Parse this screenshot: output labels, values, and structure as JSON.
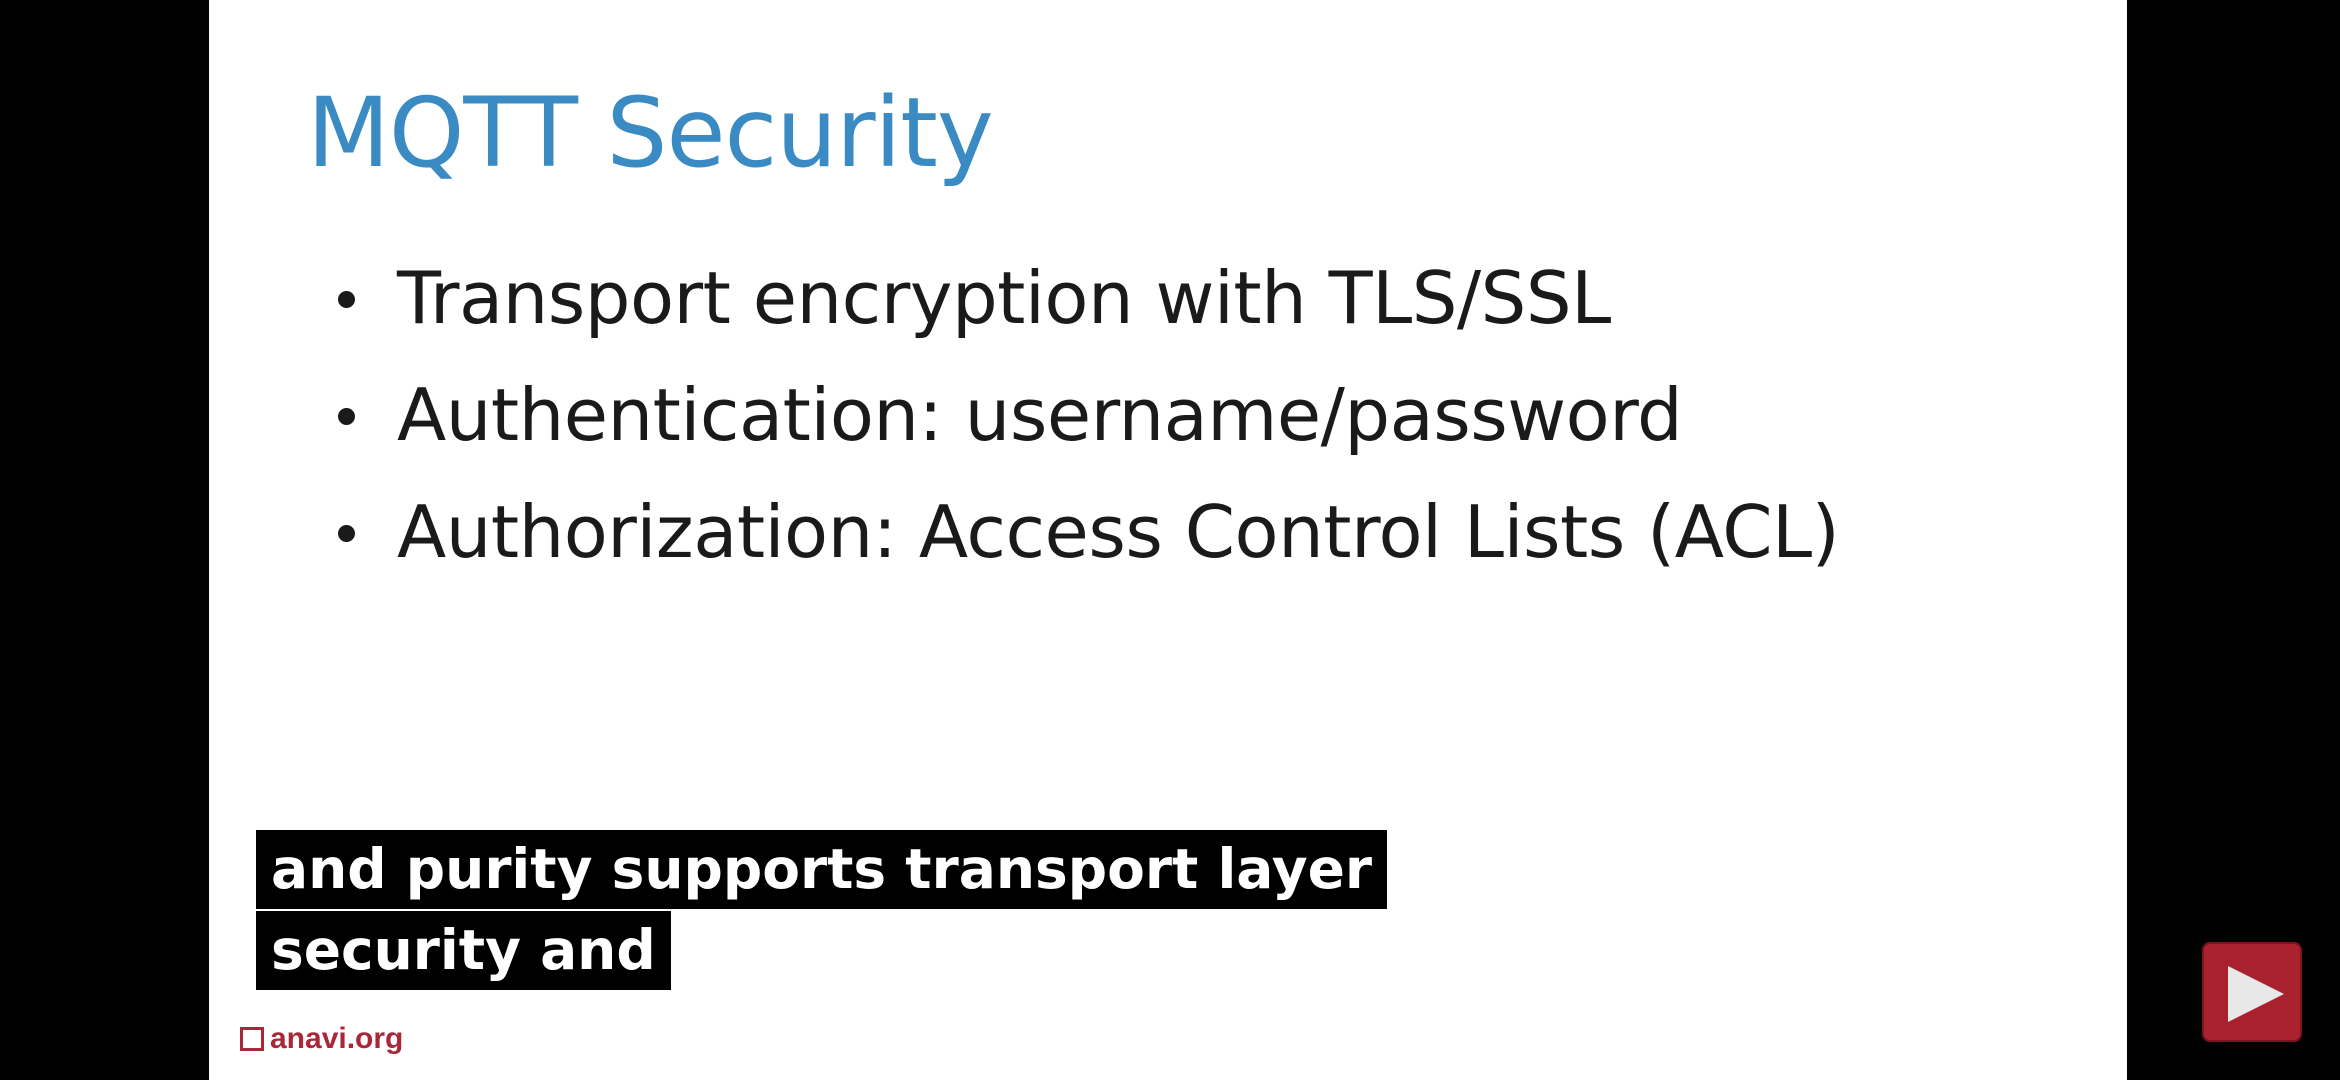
{
  "slide": {
    "title": "MQTT Security",
    "bullets": [
      "Transport encryption with TLS/SSL",
      "Authentication: username/password",
      "Authorization: Access Control Lists (ACL)"
    ],
    "footer_logo": "anavi.org"
  },
  "captions": {
    "lines": [
      "and purity supports transport layer",
      "security and"
    ]
  },
  "player": {
    "play_icon": "play-icon",
    "accent_color": "#a8212c"
  },
  "colors": {
    "title": "#3a8ac4",
    "logo": "#a8283a"
  }
}
